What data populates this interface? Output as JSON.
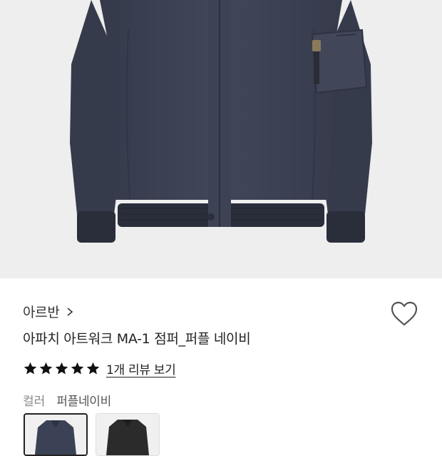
{
  "product": {
    "brand": "아르반",
    "title": "아파치 아트워크 MA-1 점퍼_퍼플 네이비",
    "rating": 5,
    "rating_max": 5,
    "review_link": "1개 리뷰 보기",
    "option_label": "컬러",
    "option_value": "퍼플네이비",
    "swatches": [
      {
        "color": "#3b4255",
        "selected": true
      },
      {
        "color": "#2b2b2b",
        "selected": false
      }
    ]
  },
  "icons": {
    "brand_chevron": "chevron-right-icon",
    "wishlist": "heart-outline-icon",
    "star": "star-filled-icon"
  },
  "colors": {
    "jacket": "#3a4052",
    "hero_bg": "#eeeeee",
    "star": "#111111"
  }
}
